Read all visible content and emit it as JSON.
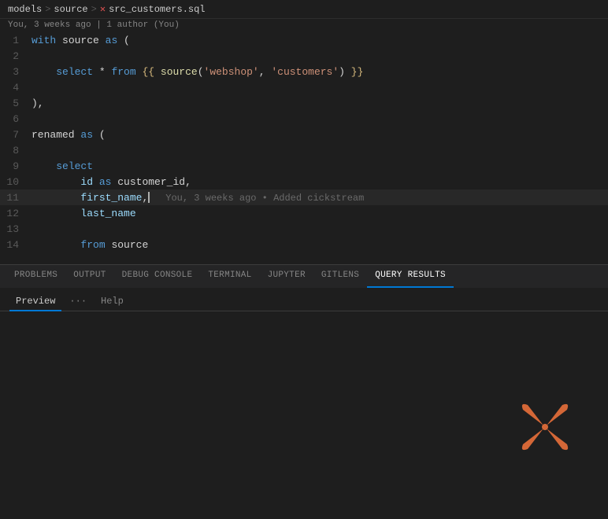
{
  "breadcrumb": {
    "items": [
      "models",
      "source",
      "src_customers.sql"
    ],
    "separators": [
      ">",
      ">"
    ],
    "file_icon": "×"
  },
  "blame": {
    "text": "You, 3 weeks ago | 1 author (You)"
  },
  "code_lines": [
    {
      "num": 1,
      "tokens": [
        {
          "t": "kw",
          "v": "with"
        },
        {
          "t": "plain",
          "v": " source "
        },
        {
          "t": "kw",
          "v": "as"
        },
        {
          "t": "plain",
          "v": " ("
        }
      ]
    },
    {
      "num": 2,
      "tokens": []
    },
    {
      "num": 3,
      "tokens": [
        {
          "t": "plain",
          "v": "    "
        },
        {
          "t": "kw",
          "v": "select"
        },
        {
          "t": "plain",
          "v": " * "
        },
        {
          "t": "kw",
          "v": "from"
        },
        {
          "t": "plain",
          "v": " "
        },
        {
          "t": "tmpl",
          "v": "{{"
        },
        {
          "t": "plain",
          "v": " "
        },
        {
          "t": "fn",
          "v": "source"
        },
        {
          "t": "plain",
          "v": "("
        },
        {
          "t": "str",
          "v": "'webshop'"
        },
        {
          "t": "plain",
          "v": ", "
        },
        {
          "t": "str",
          "v": "'customers'"
        },
        {
          "t": "plain",
          "v": ") "
        },
        {
          "t": "tmpl",
          "v": "}}"
        }
      ]
    },
    {
      "num": 4,
      "tokens": []
    },
    {
      "num": 5,
      "tokens": [
        {
          "t": "plain",
          "v": "),"
        }
      ]
    },
    {
      "num": 6,
      "tokens": []
    },
    {
      "num": 7,
      "tokens": [
        {
          "t": "plain",
          "v": "renamed "
        },
        {
          "t": "kw",
          "v": "as"
        },
        {
          "t": "plain",
          "v": " ("
        }
      ]
    },
    {
      "num": 8,
      "tokens": []
    },
    {
      "num": 9,
      "tokens": [
        {
          "t": "plain",
          "v": "    "
        },
        {
          "t": "kw",
          "v": "select"
        }
      ]
    },
    {
      "num": 10,
      "tokens": [
        {
          "t": "plain",
          "v": "        "
        },
        {
          "t": "col",
          "v": "id"
        },
        {
          "t": "plain",
          "v": " "
        },
        {
          "t": "kw",
          "v": "as"
        },
        {
          "t": "plain",
          "v": " customer_id,"
        }
      ]
    },
    {
      "num": 11,
      "tokens": [
        {
          "t": "plain",
          "v": "        "
        },
        {
          "t": "col",
          "v": "first_name"
        },
        {
          "t": "plain",
          "v": ","
        }
      ],
      "cursor_after": 1,
      "blame_inline": "You, 3 weeks ago • Added c⁠ickstream"
    },
    {
      "num": 12,
      "tokens": [
        {
          "t": "plain",
          "v": "        "
        },
        {
          "t": "col",
          "v": "last_name"
        }
      ]
    },
    {
      "num": 13,
      "tokens": []
    },
    {
      "num": 14,
      "tokens": [
        {
          "t": "plain",
          "v": "        "
        },
        {
          "t": "kw",
          "v": "from"
        },
        {
          "t": "plain",
          "v": " source"
        }
      ]
    }
  ],
  "panel_tabs": [
    {
      "label": "PROBLEMS",
      "active": false
    },
    {
      "label": "OUTPUT",
      "active": false
    },
    {
      "label": "DEBUG CONSOLE",
      "active": false
    },
    {
      "label": "TERMINAL",
      "active": false
    },
    {
      "label": "JUPYTER",
      "active": false
    },
    {
      "label": "GITLENS",
      "active": false
    },
    {
      "label": "QUERY RESULTS",
      "active": true
    }
  ],
  "panel_subtabs": {
    "preview_label": "Preview",
    "dots_label": "···",
    "help_label": "Help"
  },
  "colors": {
    "accent_blue": "#0078d4",
    "logo_orange": "#e8703a"
  }
}
